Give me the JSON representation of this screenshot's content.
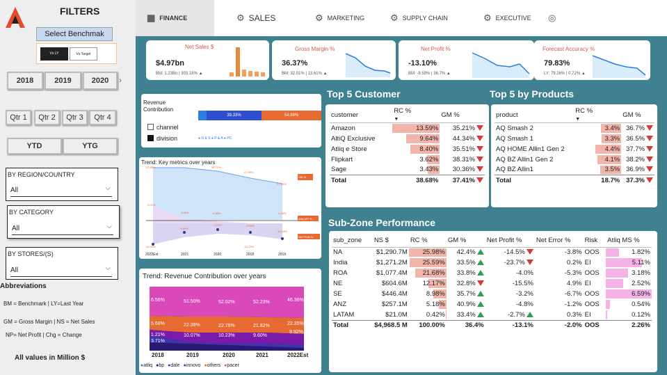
{
  "sidebar": {
    "title": "FILTERS",
    "benchmark_button": "Select Benchmak (BM)",
    "toggle_on": "Vs LY",
    "toggle_off": "Vs Target",
    "years": [
      "2018",
      "2019",
      "2020"
    ],
    "quarters": [
      "Qtr 1",
      "Qtr 2",
      "Qtr 3",
      "Qtr 4"
    ],
    "periods": [
      "YTD",
      "YTG"
    ],
    "region_label": "BY REGION/COUNTRY",
    "region_value": "All",
    "category_label": "BY CATEGORY",
    "category_value": "All",
    "stores_label": "BY STORES/(S)",
    "stores_value": "All",
    "abbr_title": "Abbreviations",
    "abbr": [
      "BM = Benchmark | LY=Last Year",
      "GM = Gross Margin | NS = Net Sales",
      "NP= Net Profit | Chg = Change"
    ],
    "all_values": "All values in Million $"
  },
  "tabs": [
    {
      "label": "FINANCE",
      "icon": "finance-icon"
    },
    {
      "label": "SALES",
      "icon": "sales-icon"
    },
    {
      "label": "MARKETING",
      "icon": "marketing-icon"
    },
    {
      "label": "SUPPLY CHAIN",
      "icon": "supply-chain-icon"
    },
    {
      "label": "EXECUTIVE",
      "icon": "executive-icon"
    }
  ],
  "kpis": [
    {
      "title": "Net Sales $",
      "value": "$4.97bn",
      "sub": "BM: 1.23Bn | 303.18% ▲",
      "spark": [
        0.12,
        0.95,
        0.22,
        0.18,
        0.15,
        0.12
      ],
      "spark_labels": [
        "2018",
        "2019",
        "2020",
        "2021",
        "2022",
        "2023"
      ]
    },
    {
      "title": "Gross Margin %",
      "value": "36.37%",
      "sub": "BM: 32.01% | 13.61% ▲",
      "spark": [
        0.85,
        0.7,
        0.45,
        0.3,
        0.28,
        0.22
      ]
    },
    {
      "title": "Net Profit %",
      "value": "-13.10%",
      "sub": "BM: -9.59% | 36.7% ▲",
      "spark": [
        0.9,
        0.75,
        0.5,
        0.45,
        0.55,
        0.2
      ]
    },
    {
      "title": "Forecast Accuracy %",
      "value": "79.83%",
      "sub": "LY: 79.26% | 0.72% ▲",
      "spark": [
        0.9,
        0.85,
        0.6,
        0.5,
        0.45,
        0.3
      ]
    }
  ],
  "revenue_contribution": {
    "title": "Revenue Contribution",
    "seg1": "39.33%",
    "seg2": "54.98%",
    "seg1_share": 0.3933,
    "seg2_share": 0.5498,
    "legend_channel": "channel",
    "legend_division": "division",
    "legend_series": "● N & S ● P & A ● PC"
  },
  "trend_metrics": {
    "title": "Trend: Key metrics over years",
    "gm_top": [
      "37.69%",
      "36.71%",
      "27.59%",
      "27.15%"
    ],
    "gm_label": "GM %",
    "ms_vals": [
      "3.07%",
      "1.06%",
      "0.36%",
      "0.26%"
    ],
    "ms_label": "Atliq MS %",
    "np_vals": [
      "-14.26%",
      "-9.69%",
      "-7.24%",
      "-9.06%",
      "-14.23%",
      "-11.04%"
    ],
    "np_label": "Net Profit %",
    "x": [
      "2022Est",
      "2021",
      "2020",
      "2018",
      "2019"
    ]
  },
  "trend_revenue": {
    "title": "Trend: Revenue Contribution over years",
    "labels": [
      "6.56%",
      "51.50%",
      "52.02%",
      "52.23%",
      "46.36%",
      "5.68%",
      "22.39%",
      "22.76%",
      "21.82%",
      "22.35%",
      "1.21%",
      "10.07%",
      "10.23%",
      "9.60%",
      "9.92%",
      "3.71%"
    ],
    "x": [
      "2018",
      "2019",
      "2020",
      "2021",
      "2022Est"
    ],
    "legend": [
      "atliq",
      "bp",
      "dale",
      "innovo",
      "others",
      "pacer"
    ]
  },
  "top_customers": {
    "title": "Top 5 Customer",
    "headers": [
      "customer",
      "RC %",
      "GM %"
    ],
    "rows": [
      {
        "name": "Amazon",
        "rc": "13.59%",
        "rcv": 13.59,
        "gm": "35.21%",
        "dir": "down"
      },
      {
        "name": "AltiQ Exclusive",
        "rc": "9.64%",
        "rcv": 9.64,
        "gm": "44.34%",
        "dir": "down"
      },
      {
        "name": "Atliq e Store",
        "rc": "8.40%",
        "rcv": 8.4,
        "gm": "35.51%",
        "dir": "down"
      },
      {
        "name": "Flipkart",
        "rc": "3.62%",
        "rcv": 3.62,
        "gm": "38.31%",
        "dir": "down"
      },
      {
        "name": "Sage",
        "rc": "3.43%",
        "rcv": 3.43,
        "gm": "30.36%",
        "dir": "down"
      }
    ],
    "total": {
      "name": "Total",
      "rc": "38.68%",
      "gm": "37.41%",
      "dir": "down"
    }
  },
  "top_products": {
    "title": "Top 5 by Products",
    "headers": [
      "product",
      "RC %",
      "GM %"
    ],
    "rows": [
      {
        "name": "AQ Smash 2",
        "rc": "3.4%",
        "rcv": 3.4,
        "gm": "36.7%",
        "dir": "down"
      },
      {
        "name": "AQ Smash 1",
        "rc": "3.3%",
        "rcv": 3.3,
        "gm": "36.5%",
        "dir": "down"
      },
      {
        "name": "AQ HOME Allin1 Gen 2",
        "rc": "4.4%",
        "rcv": 4.4,
        "gm": "37.7%",
        "dir": "down"
      },
      {
        "name": "AQ BZ Allin1 Gen 2",
        "rc": "4.1%",
        "rcv": 4.1,
        "gm": "38.2%",
        "dir": "down"
      },
      {
        "name": "AQ BZ Allin1",
        "rc": "3.5%",
        "rcv": 3.5,
        "gm": "36.9%",
        "dir": "down"
      }
    ],
    "total": {
      "name": "Total",
      "rc": "18.7%",
      "gm": "37.3%",
      "dir": "down"
    }
  },
  "subzone": {
    "title": "Sub-Zone Performance",
    "headers": [
      "sub_zone",
      "NS $",
      "RC %",
      "GM %",
      "Net Profit %",
      "Net Error %",
      "Risk",
      "Atliq MS %"
    ],
    "rows": [
      {
        "zone": "NA",
        "ns": "$1,290.7M",
        "rc": "25.98%",
        "rcv": 25.98,
        "gm": "42.4%",
        "gdir": "up",
        "np": "-14.5%",
        "ndir": "down",
        "ne": "-3.8%",
        "risk": "OOS",
        "ms": "1.82%",
        "msv": 1.82
      },
      {
        "zone": "India",
        "ns": "$1,271.2M",
        "rc": "25.59%",
        "rcv": 25.59,
        "gm": "33.5%",
        "gdir": "up",
        "np": "-23.7%",
        "ndir": "down",
        "ne": "0.2%",
        "risk": "EI",
        "ms": "5.11%",
        "msv": 5.11
      },
      {
        "zone": "ROA",
        "ns": "$1,077.4M",
        "rc": "21.68%",
        "rcv": 21.68,
        "gm": "33.8%",
        "gdir": "up",
        "np": "-4.0%",
        "ndir": "",
        "ne": "-5.3%",
        "risk": "OOS",
        "ms": "3.18%",
        "msv": 3.18
      },
      {
        "zone": "NE",
        "ns": "$604.6M",
        "rc": "12.17%",
        "rcv": 12.17,
        "gm": "32.8%",
        "gdir": "down",
        "np": "-15.5%",
        "ndir": "",
        "ne": "4.9%",
        "risk": "EI",
        "ms": "2.52%",
        "msv": 2.52
      },
      {
        "zone": "SE",
        "ns": "$446.4M",
        "rc": "8.98%",
        "rcv": 8.98,
        "gm": "35.7%",
        "gdir": "up",
        "np": "-3.2%",
        "ndir": "",
        "ne": "-6.7%",
        "risk": "OOS",
        "ms": "6.59%",
        "msv": 6.59
      },
      {
        "zone": "ANZ",
        "ns": "$257.1M",
        "rc": "5.18%",
        "rcv": 5.18,
        "gm": "40.9%",
        "gdir": "up",
        "np": "-4.8%",
        "ndir": "",
        "ne": "-1.2%",
        "risk": "OOS",
        "ms": "0.54%",
        "msv": 0.54
      },
      {
        "zone": "LATAM",
        "ns": "$21.0M",
        "rc": "0.42%",
        "rcv": 0.42,
        "gm": "33.4%",
        "gdir": "up",
        "np": "-2.7%",
        "ndir": "up",
        "ne": "0.3%",
        "risk": "EI",
        "ms": "0.12%",
        "msv": 0.12
      }
    ],
    "total": {
      "zone": "Total",
      "ns": "$4,968.5 M",
      "rc": "100.00%",
      "gm": "36.4%",
      "np": "-13.1%",
      "ne": "-2.0%",
      "risk": "OOS",
      "ms": "2.26%"
    }
  },
  "colors": {
    "teal": "#3f8191",
    "accent_red": "#d35a4a",
    "bar_pink": "#f2b5ab",
    "ms_pink": "#f4b2e6",
    "blue": "#2a7de1",
    "orange": "#e86a33"
  }
}
